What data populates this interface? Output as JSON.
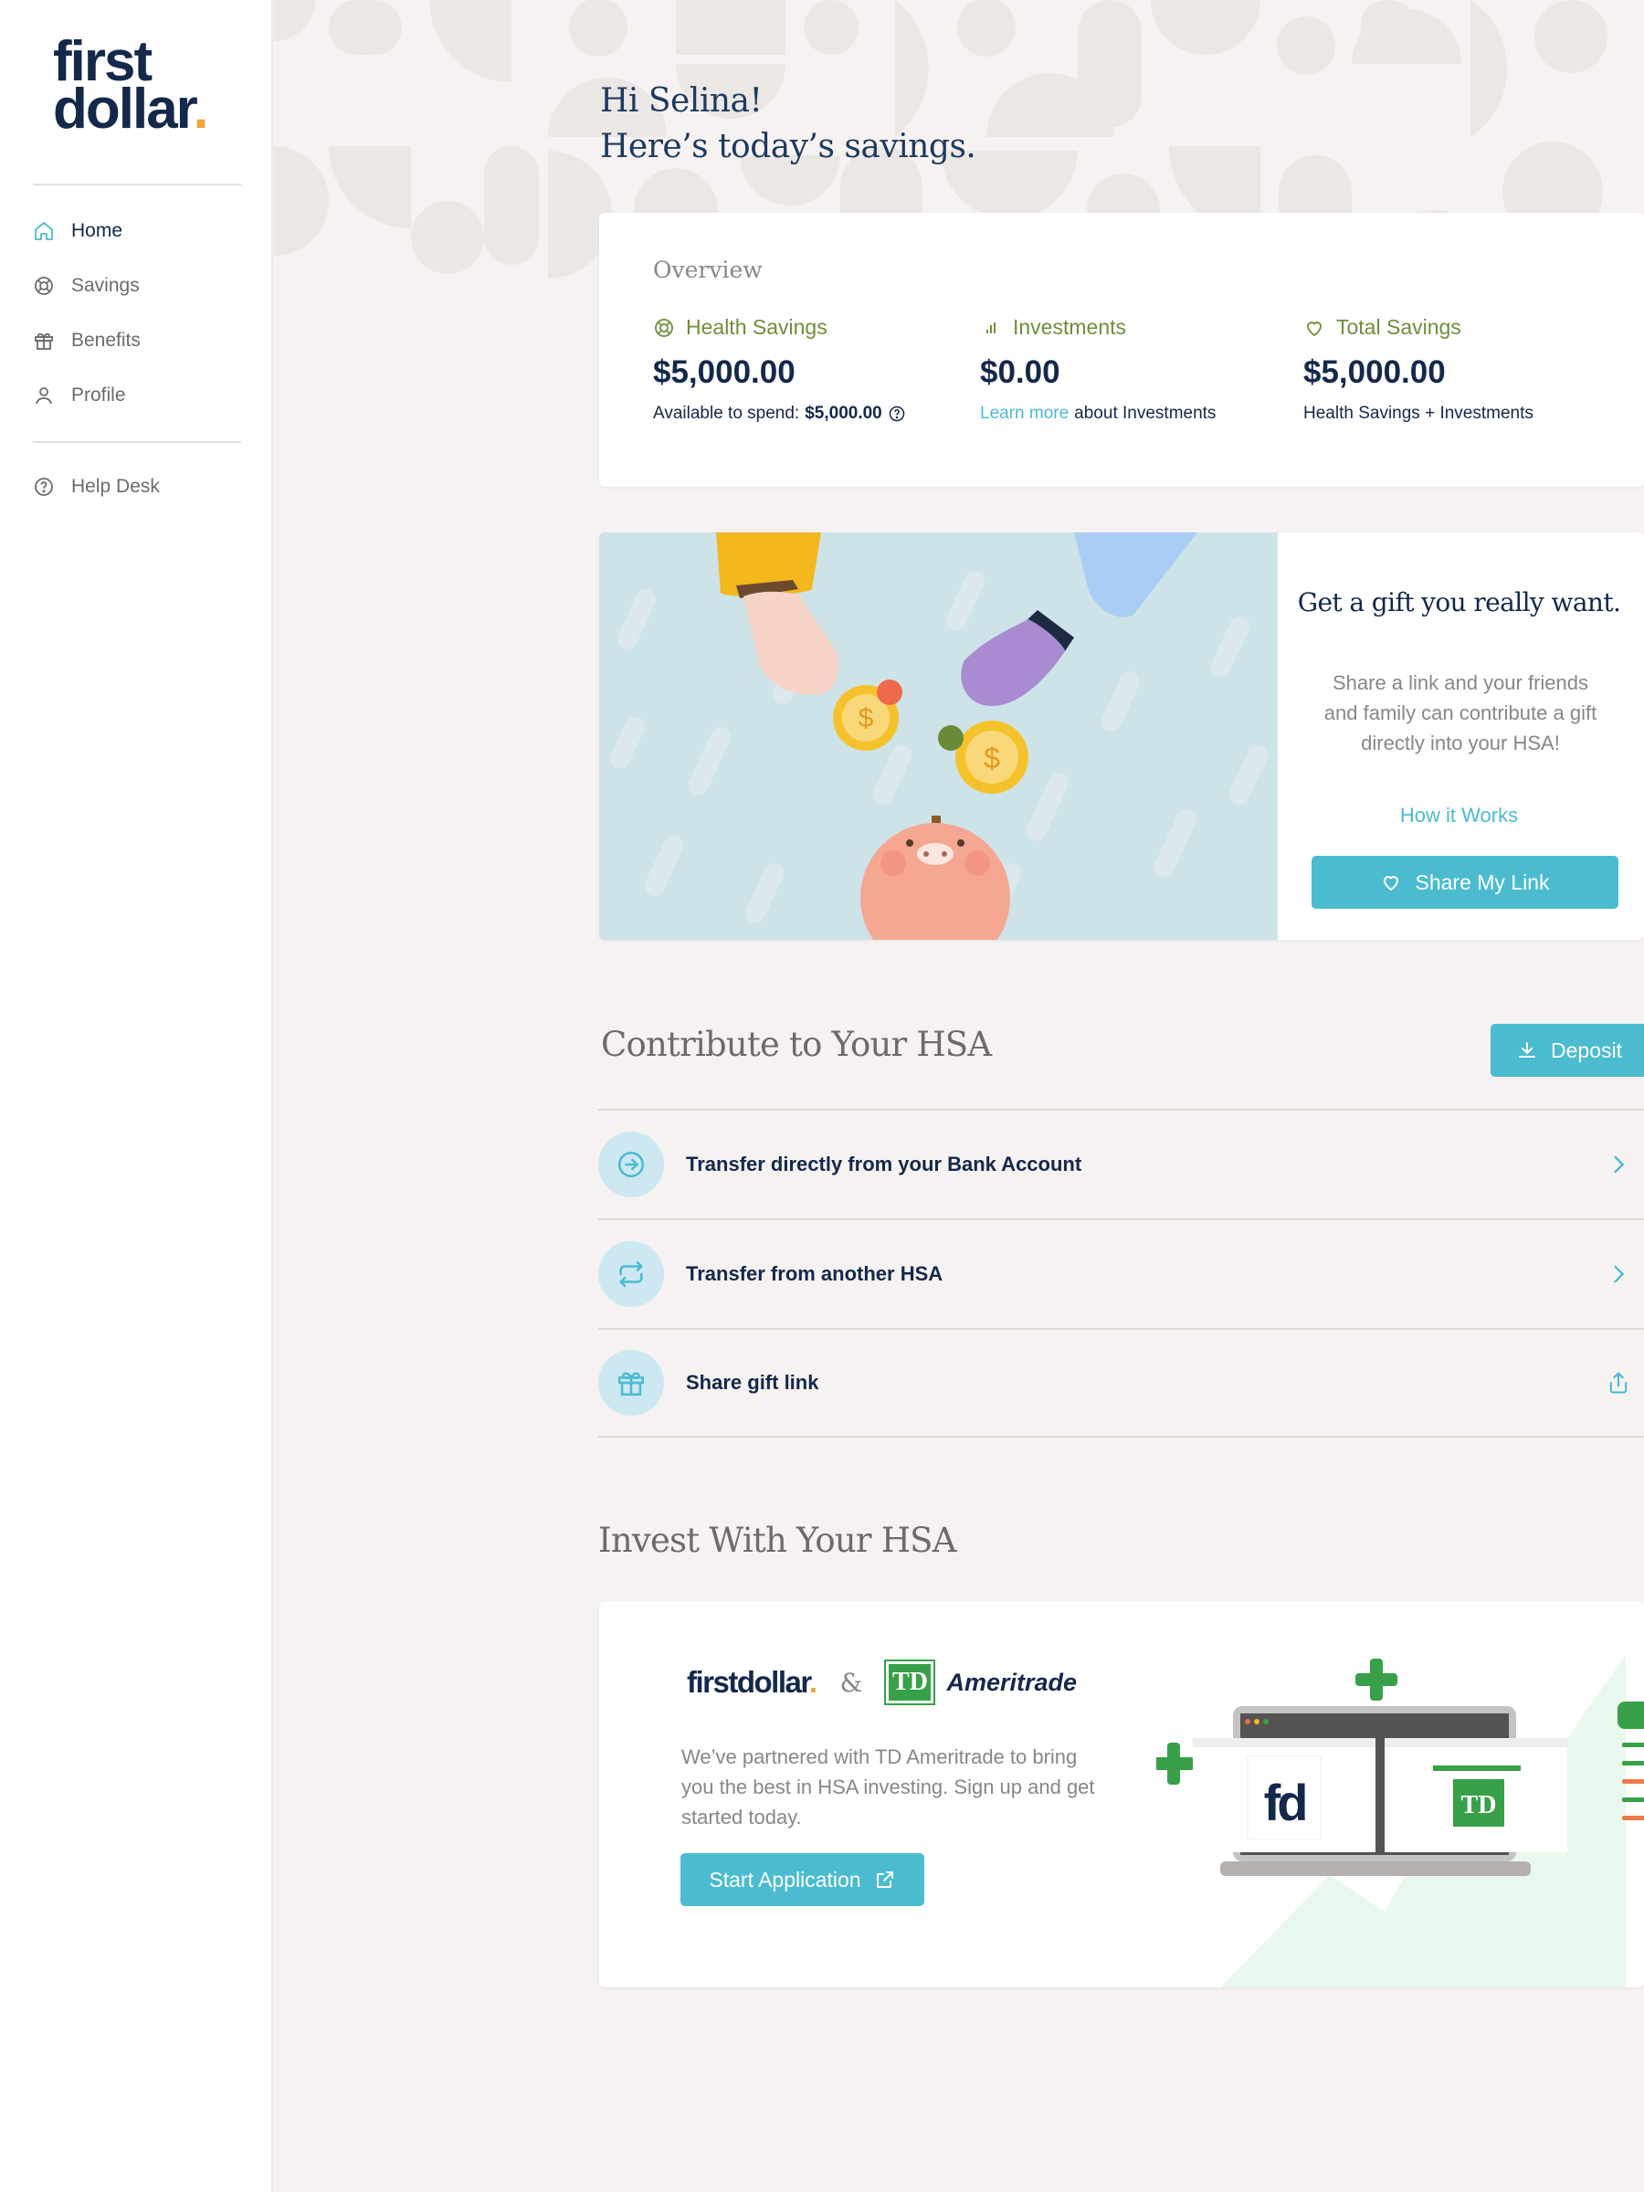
{
  "brand": {
    "line1": "first",
    "line2": "dollar",
    "dot": "."
  },
  "nav": [
    {
      "label": "Home",
      "icon": "home-icon",
      "active": true
    },
    {
      "label": "Savings",
      "icon": "lifebuoy-icon"
    },
    {
      "label": "Benefits",
      "icon": "gift-icon"
    },
    {
      "label": "Profile",
      "icon": "user-icon"
    }
  ],
  "help": {
    "label": "Help Desk",
    "icon": "help-circle-icon"
  },
  "greeting": {
    "line1": "Hi Selina!",
    "line2": "Here’s today’s savings."
  },
  "overview": {
    "title": "Overview",
    "health": {
      "label": "Health Savings",
      "value": "$5,000.00",
      "sub_prefix": "Available to spend:",
      "sub_value": "$5,000.00"
    },
    "investments": {
      "label": "Investments",
      "value": "$0.00",
      "link": "Learn more",
      "sub_suffix": "about Investments"
    },
    "total": {
      "label": "Total Savings",
      "value": "$5,000.00",
      "sub": "Health Savings + Investments"
    }
  },
  "gift": {
    "title": "Get a gift you really want.",
    "description": "Share a link and your friends and family can contribute a gift directly into your HSA!",
    "how_link": "How it Works",
    "button": "Share My Link"
  },
  "contribute": {
    "title": "Contribute to Your HSA",
    "deposit_button": "Deposit",
    "rows": [
      {
        "label": "Transfer directly from your Bank Account",
        "icon": "arrow-circle-icon",
        "tail": "chevron-right-icon"
      },
      {
        "label": "Transfer from another HSA",
        "icon": "repeat-icon",
        "tail": "chevron-right-icon"
      },
      {
        "label": "Share gift link",
        "icon": "gift-icon",
        "tail": "share-icon"
      }
    ]
  },
  "invest": {
    "title": "Invest With Your HSA",
    "brand_fd": "firstdollar",
    "amp": "&",
    "td_mark": "TD",
    "td_name": "Ameritrade",
    "description": "We’ve partnered with TD Ameritrade to bring you the best in HSA investing. Sign up and get started today.",
    "button": "Start Application",
    "screen_fd": "fd",
    "screen_td": "TD"
  },
  "colors": {
    "accent": "#4bbcd0",
    "navy": "#14284b",
    "olive": "#6f8e3a",
    "green": "#38a048"
  }
}
